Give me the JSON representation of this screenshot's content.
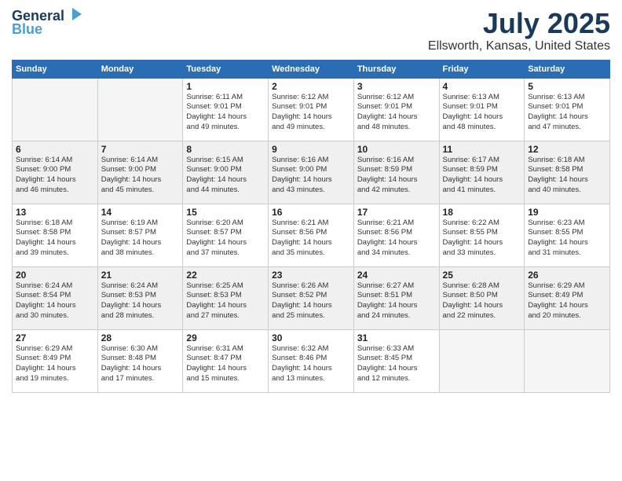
{
  "logo": {
    "line1": "General",
    "line2": "Blue"
  },
  "title": "July 2025",
  "subtitle": "Ellsworth, Kansas, United States",
  "weekdays": [
    "Sunday",
    "Monday",
    "Tuesday",
    "Wednesday",
    "Thursday",
    "Friday",
    "Saturday"
  ],
  "weeks": [
    [
      {
        "day": "",
        "info": ""
      },
      {
        "day": "",
        "info": ""
      },
      {
        "day": "1",
        "info": "Sunrise: 6:11 AM\nSunset: 9:01 PM\nDaylight: 14 hours\nand 49 minutes."
      },
      {
        "day": "2",
        "info": "Sunrise: 6:12 AM\nSunset: 9:01 PM\nDaylight: 14 hours\nand 49 minutes."
      },
      {
        "day": "3",
        "info": "Sunrise: 6:12 AM\nSunset: 9:01 PM\nDaylight: 14 hours\nand 48 minutes."
      },
      {
        "day": "4",
        "info": "Sunrise: 6:13 AM\nSunset: 9:01 PM\nDaylight: 14 hours\nand 48 minutes."
      },
      {
        "day": "5",
        "info": "Sunrise: 6:13 AM\nSunset: 9:01 PM\nDaylight: 14 hours\nand 47 minutes."
      }
    ],
    [
      {
        "day": "6",
        "info": "Sunrise: 6:14 AM\nSunset: 9:00 PM\nDaylight: 14 hours\nand 46 minutes."
      },
      {
        "day": "7",
        "info": "Sunrise: 6:14 AM\nSunset: 9:00 PM\nDaylight: 14 hours\nand 45 minutes."
      },
      {
        "day": "8",
        "info": "Sunrise: 6:15 AM\nSunset: 9:00 PM\nDaylight: 14 hours\nand 44 minutes."
      },
      {
        "day": "9",
        "info": "Sunrise: 6:16 AM\nSunset: 9:00 PM\nDaylight: 14 hours\nand 43 minutes."
      },
      {
        "day": "10",
        "info": "Sunrise: 6:16 AM\nSunset: 8:59 PM\nDaylight: 14 hours\nand 42 minutes."
      },
      {
        "day": "11",
        "info": "Sunrise: 6:17 AM\nSunset: 8:59 PM\nDaylight: 14 hours\nand 41 minutes."
      },
      {
        "day": "12",
        "info": "Sunrise: 6:18 AM\nSunset: 8:58 PM\nDaylight: 14 hours\nand 40 minutes."
      }
    ],
    [
      {
        "day": "13",
        "info": "Sunrise: 6:18 AM\nSunset: 8:58 PM\nDaylight: 14 hours\nand 39 minutes."
      },
      {
        "day": "14",
        "info": "Sunrise: 6:19 AM\nSunset: 8:57 PM\nDaylight: 14 hours\nand 38 minutes."
      },
      {
        "day": "15",
        "info": "Sunrise: 6:20 AM\nSunset: 8:57 PM\nDaylight: 14 hours\nand 37 minutes."
      },
      {
        "day": "16",
        "info": "Sunrise: 6:21 AM\nSunset: 8:56 PM\nDaylight: 14 hours\nand 35 minutes."
      },
      {
        "day": "17",
        "info": "Sunrise: 6:21 AM\nSunset: 8:56 PM\nDaylight: 14 hours\nand 34 minutes."
      },
      {
        "day": "18",
        "info": "Sunrise: 6:22 AM\nSunset: 8:55 PM\nDaylight: 14 hours\nand 33 minutes."
      },
      {
        "day": "19",
        "info": "Sunrise: 6:23 AM\nSunset: 8:55 PM\nDaylight: 14 hours\nand 31 minutes."
      }
    ],
    [
      {
        "day": "20",
        "info": "Sunrise: 6:24 AM\nSunset: 8:54 PM\nDaylight: 14 hours\nand 30 minutes."
      },
      {
        "day": "21",
        "info": "Sunrise: 6:24 AM\nSunset: 8:53 PM\nDaylight: 14 hours\nand 28 minutes."
      },
      {
        "day": "22",
        "info": "Sunrise: 6:25 AM\nSunset: 8:53 PM\nDaylight: 14 hours\nand 27 minutes."
      },
      {
        "day": "23",
        "info": "Sunrise: 6:26 AM\nSunset: 8:52 PM\nDaylight: 14 hours\nand 25 minutes."
      },
      {
        "day": "24",
        "info": "Sunrise: 6:27 AM\nSunset: 8:51 PM\nDaylight: 14 hours\nand 24 minutes."
      },
      {
        "day": "25",
        "info": "Sunrise: 6:28 AM\nSunset: 8:50 PM\nDaylight: 14 hours\nand 22 minutes."
      },
      {
        "day": "26",
        "info": "Sunrise: 6:29 AM\nSunset: 8:49 PM\nDaylight: 14 hours\nand 20 minutes."
      }
    ],
    [
      {
        "day": "27",
        "info": "Sunrise: 6:29 AM\nSunset: 8:49 PM\nDaylight: 14 hours\nand 19 minutes."
      },
      {
        "day": "28",
        "info": "Sunrise: 6:30 AM\nSunset: 8:48 PM\nDaylight: 14 hours\nand 17 minutes."
      },
      {
        "day": "29",
        "info": "Sunrise: 6:31 AM\nSunset: 8:47 PM\nDaylight: 14 hours\nand 15 minutes."
      },
      {
        "day": "30",
        "info": "Sunrise: 6:32 AM\nSunset: 8:46 PM\nDaylight: 14 hours\nand 13 minutes."
      },
      {
        "day": "31",
        "info": "Sunrise: 6:33 AM\nSunset: 8:45 PM\nDaylight: 14 hours\nand 12 minutes."
      },
      {
        "day": "",
        "info": ""
      },
      {
        "day": "",
        "info": ""
      }
    ]
  ]
}
